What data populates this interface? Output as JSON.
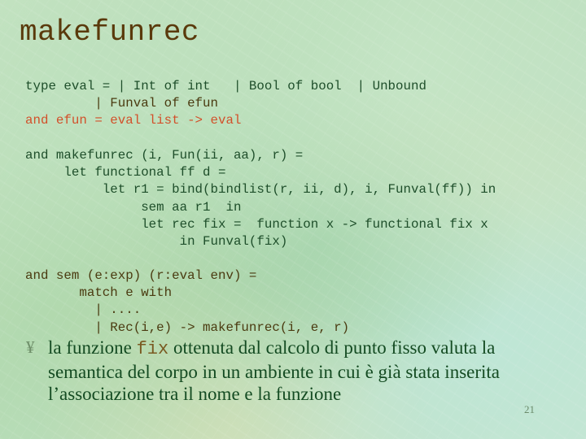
{
  "slide": {
    "title": "makefunrec",
    "page_number": "21"
  },
  "code_blocks": {
    "type_decl": [
      {
        "text": "type eval = | Int of int   | Bool of bool  | Unbound",
        "color": "#1e4e2a"
      },
      {
        "text": "         | Funval of efun",
        "color": "#4a3a10"
      },
      {
        "text": "and efun = eval list -> eval",
        "color": "#d2502a"
      }
    ],
    "makefunrec": [
      "and makefunrec (i, Fun(ii, aa), r) =",
      "     let functional ff d =",
      "          let r1 = bind(bindlist(r, ii, d), i, Funval(ff)) in",
      "               sem aa r1  in",
      "               let rec fix =  function x -> functional fix x",
      "                    in Funval(fix)"
    ],
    "sem": [
      "and sem (e:exp) (r:eval env) =",
      "       match e with",
      "         | ....",
      "         | Rec(i,e) -> makefunrec(i, e, r)"
    ]
  },
  "bullet": {
    "marker": "¥",
    "text_before": "la funzione ",
    "code": "fix",
    "text_after": " ottenuta dal calcolo di punto fisso valuta la semantica del corpo in un ambiente in cui è già stata inserita l’associazione tra il nome e la funzione"
  },
  "colors": {
    "title": "#5a3a0c",
    "code_green": "#1e4e2a",
    "code_brown": "#4a3a10",
    "code_orange": "#d2502a",
    "bullet_text": "#144b22"
  }
}
